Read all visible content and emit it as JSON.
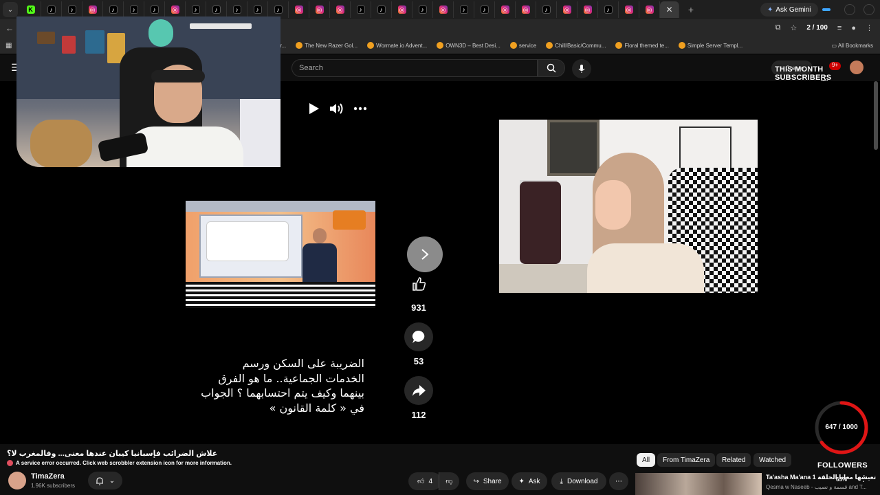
{
  "browser": {
    "tabs": [
      "kick",
      "tiktok",
      "tiktok",
      "insta",
      "tiktok",
      "tiktok",
      "tiktok",
      "insta",
      "tiktok",
      "tiktok",
      "tiktok",
      "tiktok",
      "tiktok",
      "insta",
      "insta",
      "insta",
      "tiktok",
      "tiktok",
      "insta",
      "tiktok",
      "insta",
      "tiktok",
      "tiktok",
      "insta",
      "insta",
      "tiktok",
      "insta",
      "insta",
      "tiktok",
      "insta",
      "insta"
    ],
    "ask_gemini": "Ask Gemini",
    "page_counter": "2 / 100",
    "bookmarks": [
      "rd / Str...",
      "The New Razer Gol...",
      "Wormate.io Advent...",
      "OWN3D – Best Desi...",
      "service",
      "Chill/Basic/Commu...",
      "Floral themed te...",
      "Simple Server Templ..."
    ],
    "all_bookmarks": "All Bookmarks"
  },
  "youtube": {
    "search_placeholder": "Search",
    "create_label": "+ Create",
    "notif_count": "9+"
  },
  "overlay": {
    "subscribers_label": "THIS MONTH SUBSCRIBERS",
    "subscribers_pct": "2%",
    "followers_count": "647 / 1000",
    "followers_label": "FOLLOWERS",
    "followers_progress": 0.647,
    "followers_pct": "65%"
  },
  "short": {
    "title": "الضريبة على السكن ورسم الخدمات الجماعية.. ما هو الفرق بينهما وكيف يتم احتسابهما ؟ الجواب في « كلمة القانون »",
    "likes": "931",
    "comments": "53",
    "shares": "112"
  },
  "video": {
    "title": "علاش الضرائب فإسبانيا كيبان عندها معنى... وفالمغرب لا؟",
    "scrobbler_error": "A service error occurred. Click web scrobbler extension icon for more information.",
    "channel_name": "TimaZera",
    "channel_subs": "1.96K subscribers",
    "like_count": "4",
    "share_label": "Share",
    "ask_label": "Ask",
    "download_label": "Download",
    "chips": [
      "All",
      "From TimaZera",
      "Related",
      "Watched"
    ],
    "related_title": "Ta'asha Ma'ana 1 تعيشها معانا الحلقة",
    "related_sub": "Qesma w Naseeb - قسمة و نصيب and T..."
  },
  "colors": {
    "accent_red": "#cc0000",
    "ring_red": "#e01515",
    "yt_bg": "#0f0f0f"
  }
}
